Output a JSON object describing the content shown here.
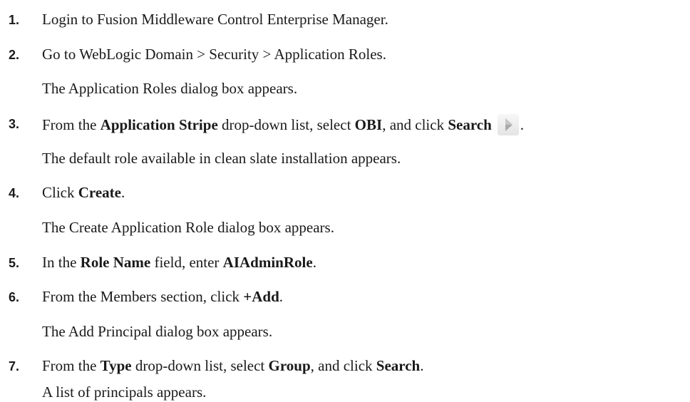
{
  "steps": [
    {
      "number": "1.",
      "text": "Login to Fusion Middleware Control Enterprise Manager."
    },
    {
      "number": "2.",
      "text": "Go to WebLogic Domain > Security > Application Roles."
    },
    {
      "result": "The Application Roles dialog box appears."
    },
    {
      "number": "3.",
      "parts": [
        "From the ",
        "Application Stripe",
        " drop-down list, select ",
        "OBI",
        ", and click ",
        "Search",
        "."
      ],
      "icon": "search-arrow-icon"
    },
    {
      "result": "The default role available in clean slate installation appears."
    },
    {
      "number": "4.",
      "parts": [
        "Click ",
        "Create",
        "."
      ]
    },
    {
      "result": "The Create Application Role dialog box appears."
    },
    {
      "number": "5.",
      "parts": [
        "In the ",
        "Role Name",
        " field, enter ",
        "AIAdminRole",
        "."
      ]
    },
    {
      "number": "6.",
      "parts": [
        "From the Members section, click ",
        "+Add",
        "."
      ]
    },
    {
      "result": "The Add Principal dialog box appears."
    },
    {
      "number": "7.",
      "parts": [
        "From the ",
        "Type",
        " drop-down list, select ",
        "Group",
        ", and click ",
        "Search",
        "."
      ]
    },
    {
      "result": "A list of principals appears."
    }
  ]
}
